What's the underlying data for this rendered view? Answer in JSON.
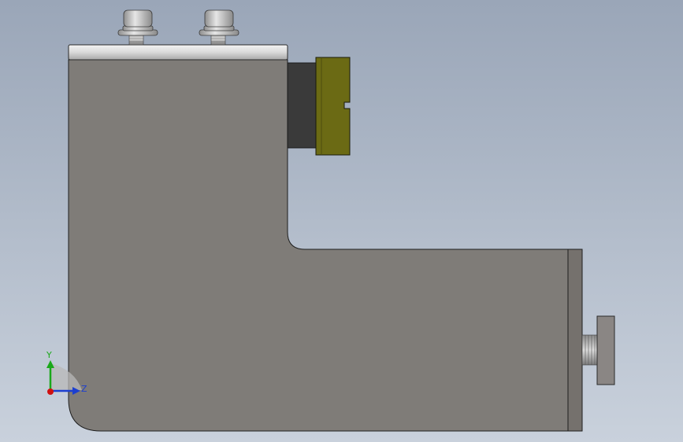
{
  "viewport": {
    "background_top": "#9aa6b8",
    "background_bottom": "#c9d1dc"
  },
  "part": {
    "body_color": "#7f7c78",
    "edge_color": "#1e1e1e",
    "top_plate_color": "#d9d9d9",
    "end_plate_color": "#75716d",
    "spacer_color": "#3a3a3a",
    "gripper_color": "#6b6a14",
    "screw_color": "#bfbfbf",
    "adjuster_color": "#8a8684"
  },
  "triad": {
    "y_label": "Y",
    "z_label": "Z",
    "y_color": "#1aa81a",
    "z_color": "#1c3fd0",
    "origin_color": "#d01010"
  }
}
